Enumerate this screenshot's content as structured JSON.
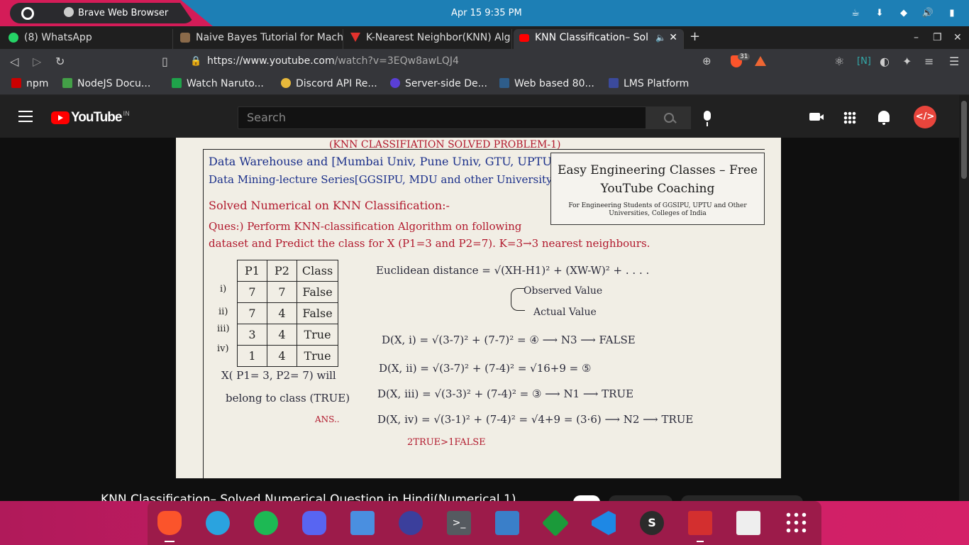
{
  "system": {
    "app_title": "Brave Web Browser",
    "clock": "Apr 15  9:35 PM"
  },
  "tabs": [
    {
      "label": "(8) WhatsApp",
      "color": "#25d366"
    },
    {
      "label": "Naive Bayes Tutorial for Mach",
      "color": "#8a6a4a"
    },
    {
      "label": "K-Nearest Neighbor(KNN) Alg",
      "color": "#e2322d"
    },
    {
      "label": "KNN Classification– Sol",
      "color": "#ff0000"
    }
  ],
  "address_bar": {
    "url_host": "https://www.youtube.com",
    "url_path": "/watch?v=3EQw8awLQJ4",
    "shield_badge": "31"
  },
  "bookmarks": [
    {
      "label": "npm",
      "color": "#cb0000"
    },
    {
      "label": "NodeJS Docu...",
      "color": "#43a047"
    },
    {
      "label": "Watch Naruto...",
      "color": "#1fa34a"
    },
    {
      "label": "Discord API Re...",
      "color": "#e8b93b"
    },
    {
      "label": "Server-side De...",
      "color": "#5a3fd6"
    },
    {
      "label": "Web based 80...",
      "color": "#2e5d8a"
    },
    {
      "label": "LMS Platform",
      "color": "#3b4a9c"
    }
  ],
  "youtube": {
    "logo_text": "YouTube",
    "country": "IN",
    "search_placeholder": "Search"
  },
  "video": {
    "heading": "(KNN CLASSIFIATION SOLVED PROBLEM-1)",
    "line1": "Data Warehouse and [Mumbai Univ, Pune Univ, GTU, UPTU,",
    "line2": "Data Mining-lecture Series[GGSIPU, MDU and other University]",
    "solved": "Solved Numerical on KNN Classification:-",
    "ques": "Ques:) Perform KNN-classification Algorithm on following",
    "ques2": "dataset and Predict the class for X (P1=3 and P2=7). K=3→3 nearest neighbours.",
    "table_header": [
      "P1",
      "P2",
      "Class"
    ],
    "table_rows": [
      {
        "idx": "i)",
        "p1": "7",
        "p2": "7",
        "cls": "False"
      },
      {
        "idx": "ii)",
        "p1": "7",
        "p2": "4",
        "cls": "False"
      },
      {
        "idx": "iii)",
        "p1": "3",
        "p2": "4",
        "cls": "True"
      },
      {
        "idx": "iv)",
        "p1": "1",
        "p2": "4",
        "cls": "True"
      }
    ],
    "euclid": "Euclidean distance = √(XH-H1)² + (XW-W)² + . . . .",
    "observed": "Observed Value",
    "actual": "Actual Value",
    "d1": "D(X, i) = √(3-7)² + (7-7)² = ④ ⟶ N3 ⟶ FALSE",
    "d2": "D(X, ii) = √(3-7)² + (7-4)² = √16+9 = ⑤",
    "d3": "D(X, iii) = √(3-3)² + (7-4)² = ③ ⟶ N1 ⟶ TRUE",
    "d4": "D(X, iv) = √(3-1)² + (7-4)² = √4+9 = (3·6) ⟶ N2 ⟶ TRUE",
    "votes": "2TRUE>1FALSE",
    "belong1": "X( P1= 3, P2= 7) will",
    "belong2": "belong to class (TRUE)",
    "ans": "ANS..",
    "easy_title": "Easy Engineering Classes – Free YouTube Coaching",
    "easy_sub": "For Engineering Students of GGSIPU, UPTU and Other Universities, Colleges of India"
  },
  "video_title": "KNN Classification– Solved Numerical Question in Hindi(Numerical 1)",
  "dock_apps": [
    {
      "name": "brave",
      "color": "#fb542b"
    },
    {
      "name": "telegram",
      "color": "#2aa3df"
    },
    {
      "name": "spotify",
      "color": "#1db954"
    },
    {
      "name": "discord",
      "color": "#5865f2"
    },
    {
      "name": "files",
      "color": "#4a8fe0"
    },
    {
      "name": "monitor",
      "color": "#3b3f9c"
    },
    {
      "name": "terminal",
      "color": "#555a60"
    },
    {
      "name": "text-editor",
      "color": "#3a7fc9"
    },
    {
      "name": "vim",
      "color": "#1b9a3a"
    },
    {
      "name": "vscode",
      "color": "#1e88e5"
    },
    {
      "name": "s-app",
      "color": "#2b2b2b"
    },
    {
      "name": "pdf-reader",
      "color": "#d32f2f"
    },
    {
      "name": "recycle",
      "color": "#e8e8e8"
    },
    {
      "name": "app-grid",
      "color": "#ffffff"
    }
  ]
}
